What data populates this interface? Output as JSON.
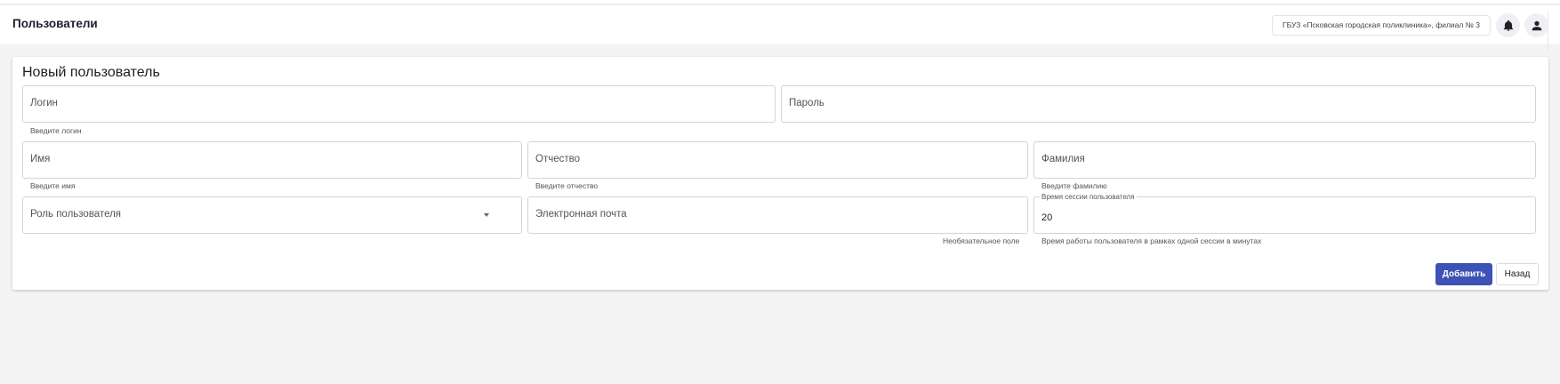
{
  "header": {
    "title": "Пользователи",
    "organization": "ГБУЗ «Псковская городская поликлиника», филиал № 3",
    "notifications_icon": "bell-icon",
    "account_icon": "user-icon"
  },
  "form": {
    "title": "Новый пользователь",
    "login": {
      "label": "Логин",
      "hint": "Введите логин"
    },
    "password": {
      "label": "Пароль"
    },
    "first_name": {
      "label": "Имя",
      "hint": "Введите имя"
    },
    "patronymic": {
      "label": "Отчество",
      "hint": "Введите отчество"
    },
    "last_name": {
      "label": "Фамилия",
      "hint": "Введите фамилию"
    },
    "role": {
      "label": "Роль пользователя"
    },
    "email": {
      "label": "Электронная почта",
      "hint": "Необязательное поле"
    },
    "session_time": {
      "label": "Время сессии пользователя",
      "value": "20",
      "hint": "Время работы пользователя в рамках одной сессии в минутах"
    },
    "add_label": "Добавить",
    "back_label": "Назад"
  },
  "colors": {
    "primary": "#3d52b5",
    "background": "#f4f4f4"
  }
}
